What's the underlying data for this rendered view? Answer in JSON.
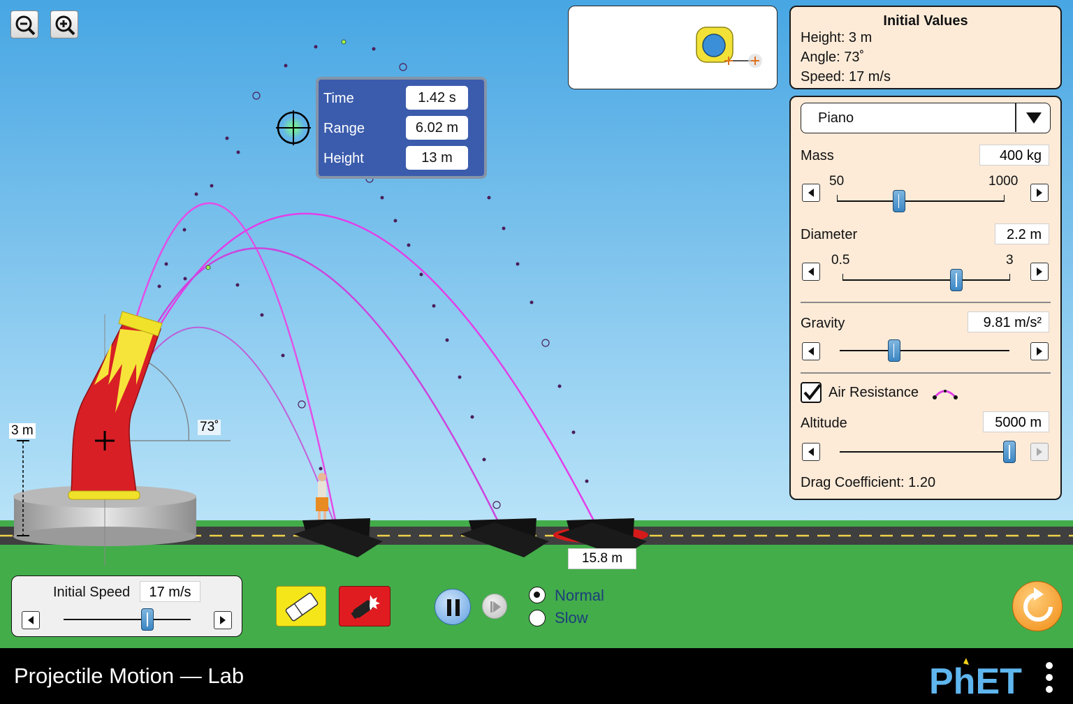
{
  "app": {
    "title": "Projectile Motion — Lab",
    "brand": "PhET"
  },
  "colors": {
    "sky": "#4aa8e4",
    "grass": "#43ad4a",
    "panel": "#fdebd8",
    "trajectory": "#d43ee0",
    "readout": "#3b5cad",
    "cannon": "#d81f26"
  },
  "icons": {
    "zoom_out": "zoom-out-icon",
    "zoom_in": "zoom-in-icon",
    "tape_measure": "tape-measure-icon",
    "eraser": "eraser-icon",
    "fire": "fire-cannon-icon",
    "pause": "pause-icon",
    "step": "step-forward-icon",
    "reset": "reset-icon",
    "menu": "kebab-menu-icon"
  },
  "initial_values": {
    "title": "Initial Values",
    "height": "Height: 3 m",
    "angle": "Angle: 73˚",
    "speed": "Speed: 17 m/s"
  },
  "projectile": {
    "selected": "Piano",
    "mass": {
      "label": "Mass",
      "value": "400 kg",
      "min": "50",
      "max": "1000",
      "level": 0.37
    },
    "diameter": {
      "label": "Diameter",
      "value": "2.2 m",
      "min": "0.5",
      "max": "3",
      "level": 0.68
    },
    "gravity": {
      "label": "Gravity",
      "value": "9.81 m/s²",
      "level": 0.32
    },
    "air_resistance": {
      "label": "Air Resistance",
      "checked": true
    },
    "altitude": {
      "label": "Altitude",
      "value": "5000 m",
      "level": 1.0
    },
    "drag": "Drag Coefficient: 1.20"
  },
  "readout": {
    "time_label": "Time",
    "time_value": "1.42 s",
    "range_label": "Range",
    "range_value": "6.02 m",
    "height_label": "Height",
    "height_value": "13 m"
  },
  "cannon": {
    "height_label": "3 m",
    "angle_label": "73˚"
  },
  "target": {
    "distance": "15.8 m"
  },
  "initial_speed": {
    "label": "Initial Speed",
    "value": "17 m/s",
    "level": 0.66
  },
  "playback": {
    "normal": "Normal",
    "slow": "Slow",
    "selected": "Normal"
  }
}
